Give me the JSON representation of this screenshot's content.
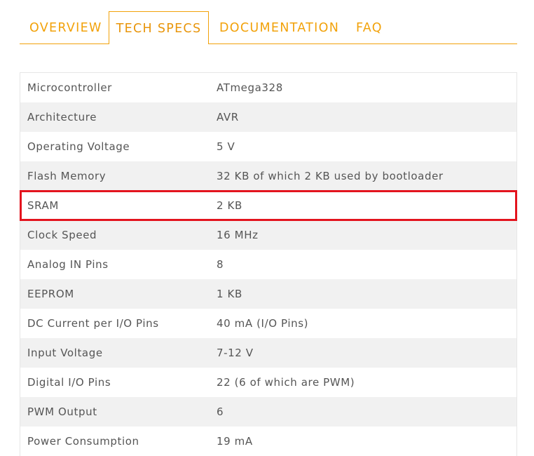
{
  "tabs": [
    {
      "label": "OVERVIEW"
    },
    {
      "label": "TECH SPECS",
      "active": true
    },
    {
      "label": "DOCUMENTATION"
    },
    {
      "label": "FAQ"
    }
  ],
  "specs": {
    "rows": [
      {
        "key": "Microcontroller",
        "value": "ATmega328"
      },
      {
        "key": "Architecture",
        "value": "AVR"
      },
      {
        "key": "Operating Voltage",
        "value": "5 V"
      },
      {
        "key": "Flash Memory",
        "value": "32 KB of which 2 KB used by bootloader"
      },
      {
        "key": "SRAM",
        "value": "2 KB"
      },
      {
        "key": "Clock Speed",
        "value": "16 MHz"
      },
      {
        "key": "Analog IN Pins",
        "value": "8"
      },
      {
        "key": "EEPROM",
        "value": "1 KB"
      },
      {
        "key": "DC Current per I/O Pins",
        "value": "40 mA (I/O Pins)"
      },
      {
        "key": "Input Voltage",
        "value": "7-12 V"
      },
      {
        "key": "Digital I/O Pins",
        "value": "22 (6 of which are PWM)"
      },
      {
        "key": "PWM Output",
        "value": "6"
      },
      {
        "key": "Power Consumption",
        "value": "19 mA"
      }
    ],
    "highlighted_row": "SRAM"
  },
  "colors": {
    "accent": "#f2a20a",
    "highlight_border": "#e3141e",
    "row_alt": "#f1f1f1",
    "text": "#555555"
  }
}
